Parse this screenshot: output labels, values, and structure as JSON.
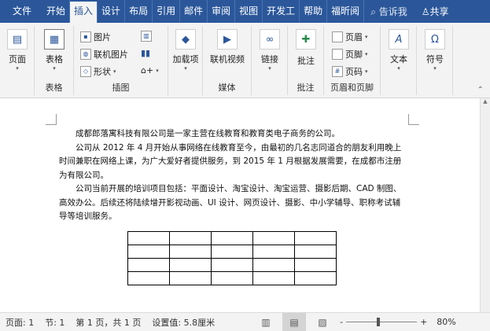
{
  "tabs": [
    "文件",
    "开始",
    "插入",
    "设计",
    "布局",
    "引用",
    "邮件",
    "审阅",
    "视图",
    "开发工",
    "帮助",
    "福昕阅"
  ],
  "tell_me": "告诉我",
  "share": "共享",
  "ribbon": {
    "pages": "页面",
    "table": "表格",
    "table_group": "表格",
    "picture": "图片",
    "online_picture": "联机图片",
    "shapes": "形状",
    "illustrations_group": "插图",
    "addins": "加载项",
    "online_video": "联机视频",
    "media_group": "媒体",
    "link": "链接",
    "comment": "批注",
    "comment_group": "批注",
    "header": "页眉",
    "footer": "页脚",
    "page_number": "页码",
    "header_footer_group": "页眉和页脚",
    "text": "文本",
    "symbol": "符号"
  },
  "document": {
    "paragraphs": [
      "成都郎落寓科技有限公司是一家主营在线教育和教育类电子商务的公司。",
      "公司从 2012 年 4 月开始从事网络在线教育至今，由最初的几名志同道合的朋友利用晚上时间兼职在网络上课，为广大爱好者提供服务，到 2015 年 1 月根据发展需要，在成都市注册为有限公司。",
      "公司当前开展的培训项目包括：平面设计、淘宝设计、淘宝运营、摄影后期、CAD 制图、高效办公。后续还将陆续增开影视动画、UI 设计、网页设计、摄影、中小学辅导、职称考试辅导等培训服务。"
    ],
    "table": {
      "rows": 4,
      "cols": 5
    }
  },
  "status": {
    "page": "页面: 1",
    "section": "节: 1",
    "page_of": "第 1 页，共 1 页",
    "setting": "设置值: 5.8厘米",
    "zoom": "80%",
    "zoom_fraction": 0.45
  }
}
